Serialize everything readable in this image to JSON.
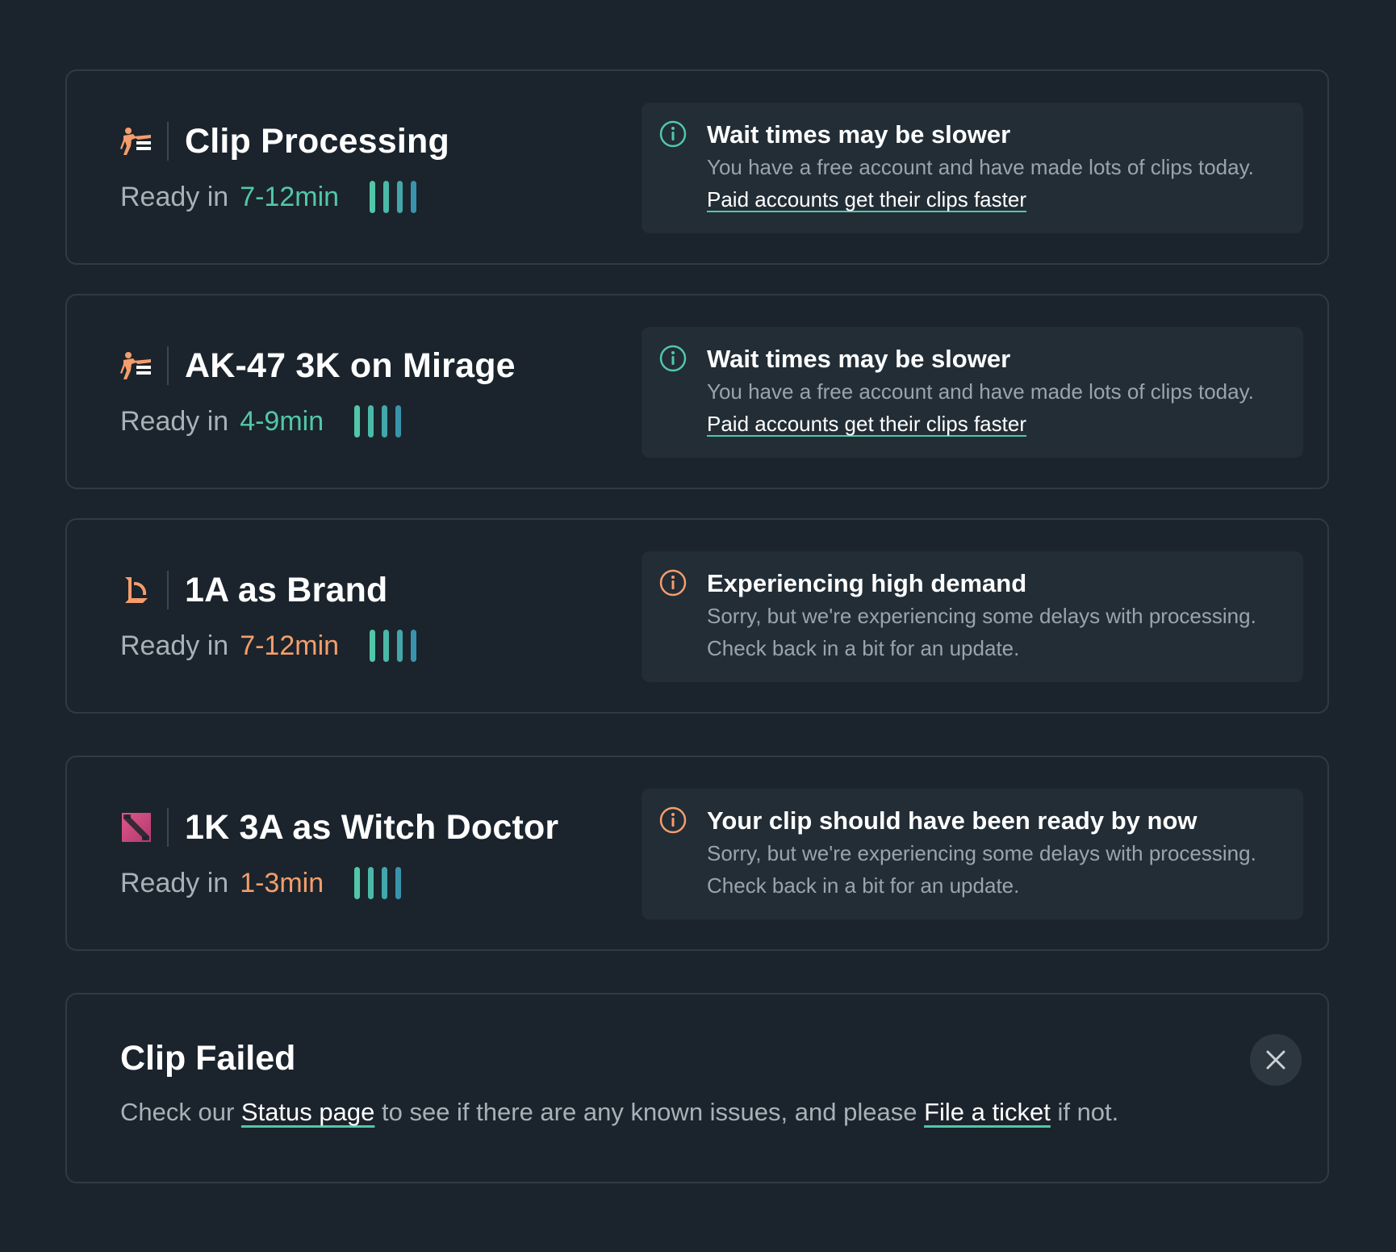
{
  "colors": {
    "background": "#1b242c",
    "card_border": "#2f3a43",
    "notice_background": "#222d36",
    "teal": "#52c7a8",
    "orange": "#f59d6c",
    "muted_text": "#a8b1b8"
  },
  "clips": [
    {
      "game_icon": "csgo-icon",
      "title": "Clip Processing",
      "ready_label": "Ready in",
      "ready_time": "7-12min",
      "time_color": "teal",
      "notice": {
        "icon": "info-icon",
        "icon_color": "teal",
        "title": "Wait times may be slower",
        "body": "You have a free account and have made lots of clips today.",
        "link": "Paid accounts get their clips faster"
      }
    },
    {
      "game_icon": "csgo-icon",
      "title": "AK-47 3K on Mirage",
      "ready_label": "Ready in",
      "ready_time": "4-9min",
      "time_color": "teal",
      "notice": {
        "icon": "info-icon",
        "icon_color": "teal",
        "title": "Wait times may be slower",
        "body": "You have a free account and have made lots of clips today.",
        "link": "Paid accounts get their clips faster"
      }
    },
    {
      "game_icon": "league-of-legends-icon",
      "title": "1A as Brand",
      "ready_label": "Ready in",
      "ready_time": "7-12min",
      "time_color": "orange",
      "notice": {
        "icon": "info-icon",
        "icon_color": "orange",
        "title": "Experiencing high demand",
        "body": "Sorry, but we're experiencing some delays with processing.",
        "body2": "Check back in a bit for an update."
      }
    },
    {
      "game_icon": "dota-icon",
      "title": "1K 3A as Witch Doctor",
      "ready_label": "Ready in",
      "ready_time": "1-3min",
      "time_color": "orange",
      "notice": {
        "icon": "info-icon",
        "icon_color": "orange",
        "title": "Your clip should have been ready by now",
        "body": "Sorry, but we're experiencing some delays with processing.",
        "body2": "Check back in a bit for an update."
      }
    }
  ],
  "failed": {
    "title": "Clip Failed",
    "text_1": "Check our ",
    "status_link": "Status page",
    "text_2": " to see if there are any known issues, and please ",
    "ticket_link": "File a ticket",
    "text_3": " if not.",
    "close_icon": "close-icon"
  }
}
